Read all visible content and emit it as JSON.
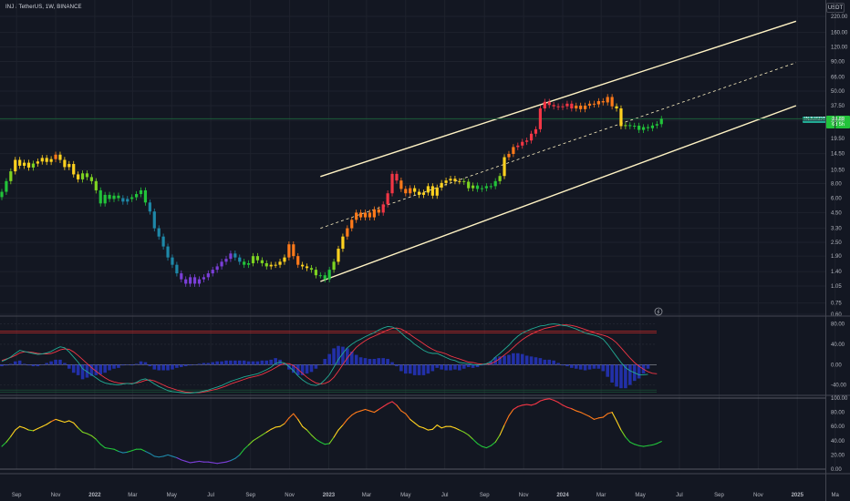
{
  "header": {
    "title": "INJ / TetherUS, 1W, BINANCE",
    "unit": "USDT"
  },
  "price_axis": {
    "ticks": [
      "220.00",
      "160.00",
      "120.00",
      "90.00",
      "66.00",
      "50.00",
      "37.50",
      "28.00",
      "19.50",
      "14.50",
      "10.50",
      "8.00",
      "6.00",
      "4.50",
      "3.30",
      "2.50",
      "1.90",
      "1.40",
      "1.05",
      "0.75",
      "0.60"
    ]
  },
  "osc1_axis": {
    "ticks": [
      "80.00",
      "40.00",
      "0.00",
      "-40.00"
    ]
  },
  "osc2_axis": {
    "ticks": [
      "100.00",
      "80.00",
      "60.00",
      "40.00",
      "20.00",
      "0.00"
    ]
  },
  "time_axis": {
    "labels": [
      "Sep",
      "Nov",
      "2022",
      "Mar",
      "May",
      "Jul",
      "Sep",
      "Nov",
      "2023",
      "Mar",
      "May",
      "Jul",
      "Sep",
      "Nov",
      "2024",
      "Mar",
      "May",
      "Jul",
      "Sep",
      "Nov",
      "2025",
      "Ma"
    ]
  },
  "last_price": {
    "symbol_tag": "INJUSDT",
    "price": "28.89",
    "countdown": "6d 5h"
  },
  "colors": {
    "background": "#131722",
    "channel": "#fff3c4",
    "grid": "#1e222d",
    "separator": "#434651",
    "bull_up": "#22c33a",
    "bear": "#f23645"
  },
  "chart_data": [
    {
      "type": "candlestick",
      "title": "",
      "xlabel": "",
      "ylabel": "",
      "y_scale": "log",
      "ylim": [
        0.6,
        220
      ],
      "x": [
        "2021-08-09",
        "2021-08-16",
        "2021-08-23",
        "2021-08-30",
        "2021-09-06",
        "2021-09-13",
        "2021-09-20",
        "2021-09-27",
        "2021-10-04",
        "2021-10-11",
        "2021-10-18",
        "2021-10-25",
        "2021-11-01",
        "2021-11-08",
        "2021-11-15",
        "2021-11-22",
        "2021-11-29",
        "2021-12-06",
        "2021-12-13",
        "2021-12-20",
        "2021-12-27",
        "2022-01-03",
        "2022-01-10",
        "2022-01-17",
        "2022-01-24",
        "2022-01-31",
        "2022-02-07",
        "2022-02-14",
        "2022-02-21",
        "2022-02-28",
        "2022-03-07",
        "2022-03-14",
        "2022-03-21",
        "2022-03-28",
        "2022-04-04",
        "2022-04-11",
        "2022-04-18",
        "2022-04-25",
        "2022-05-02",
        "2022-05-09",
        "2022-05-16",
        "2022-05-23",
        "2022-05-30",
        "2022-06-06",
        "2022-06-13",
        "2022-06-20",
        "2022-06-27",
        "2022-07-04",
        "2022-07-11",
        "2022-07-18",
        "2022-07-25",
        "2022-08-01",
        "2022-08-08",
        "2022-08-15",
        "2022-08-22",
        "2022-08-29",
        "2022-09-05",
        "2022-09-12",
        "2022-09-19",
        "2022-09-26",
        "2022-10-03",
        "2022-10-10",
        "2022-10-17",
        "2022-10-24",
        "2022-10-31",
        "2022-11-07",
        "2022-11-14",
        "2022-11-21",
        "2022-11-28",
        "2022-12-05",
        "2022-12-12",
        "2022-12-19",
        "2022-12-26",
        "2023-01-02",
        "2023-01-09",
        "2023-01-16",
        "2023-01-23",
        "2023-01-30",
        "2023-02-06",
        "2023-02-13",
        "2023-02-20",
        "2023-02-27",
        "2023-03-06",
        "2023-03-13",
        "2023-03-20",
        "2023-03-27",
        "2023-04-03",
        "2023-04-10",
        "2023-04-17",
        "2023-04-24",
        "2023-05-01",
        "2023-05-08",
        "2023-05-15",
        "2023-05-22",
        "2023-05-29",
        "2023-06-05",
        "2023-06-12",
        "2023-06-19",
        "2023-06-26",
        "2023-07-03",
        "2023-07-10",
        "2023-07-17",
        "2023-07-24",
        "2023-07-31",
        "2023-08-07",
        "2023-08-14",
        "2023-08-21",
        "2023-08-28",
        "2023-09-04",
        "2023-09-11",
        "2023-09-18",
        "2023-09-25",
        "2023-10-02",
        "2023-10-09",
        "2023-10-16",
        "2023-10-23",
        "2023-10-30",
        "2023-11-06",
        "2023-11-13",
        "2023-11-20",
        "2023-11-27",
        "2023-12-04",
        "2023-12-11",
        "2023-12-18",
        "2023-12-25",
        "2024-01-01",
        "2024-01-08",
        "2024-01-15",
        "2024-01-22",
        "2024-01-29",
        "2024-02-05",
        "2024-02-12",
        "2024-02-19",
        "2024-02-26",
        "2024-03-04",
        "2024-03-11",
        "2024-03-18",
        "2024-03-25",
        "2024-04-01",
        "2024-04-08",
        "2024-04-15",
        "2024-04-22",
        "2024-04-29",
        "2024-05-06",
        "2024-05-13",
        "2024-05-20",
        "2024-05-27",
        "2024-06-03"
      ],
      "close": [
        6.8,
        8.4,
        10.2,
        12.8,
        11.4,
        12.1,
        11.0,
        11.9,
        12.4,
        13.3,
        12.3,
        13.0,
        14.2,
        12.8,
        11.1,
        11.8,
        9.6,
        8.7,
        9.8,
        9.1,
        8.4,
        7.0,
        5.4,
        6.4,
        5.9,
        6.3,
        6.0,
        5.6,
        5.9,
        6.1,
        6.5,
        7.0,
        5.5,
        4.6,
        3.3,
        2.8,
        2.3,
        1.85,
        1.6,
        1.35,
        1.2,
        1.1,
        1.25,
        1.1,
        1.2,
        1.25,
        1.35,
        1.45,
        1.55,
        1.7,
        1.8,
        2.0,
        1.85,
        1.7,
        1.6,
        1.65,
        1.9,
        1.75,
        1.65,
        1.55,
        1.6,
        1.6,
        1.7,
        1.85,
        2.4,
        1.9,
        1.6,
        1.55,
        1.5,
        1.45,
        1.3,
        1.3,
        1.2,
        1.45,
        1.7,
        2.2,
        2.8,
        3.3,
        3.9,
        4.5,
        4.1,
        4.5,
        4.1,
        4.8,
        4.5,
        5.3,
        6.6,
        9.7,
        8.5,
        7.2,
        6.6,
        7.3,
        6.8,
        6.4,
        6.7,
        7.6,
        6.3,
        7.4,
        8.1,
        8.5,
        8.8,
        8.4,
        8.4,
        8.3,
        7.3,
        7.7,
        7.2,
        7.3,
        7.6,
        7.6,
        8.4,
        9.3,
        13.5,
        14.4,
        16.5,
        17.0,
        18.3,
        18.8,
        21.5,
        23.5,
        35.5,
        40.5,
        38.0,
        37.0,
        36.5,
        37.0,
        39.0,
        35.5,
        37.5,
        35.0,
        37.5,
        39.0,
        38.5,
        41.0,
        40.0,
        44.5,
        37.0,
        35.5,
        25.0,
        25.5,
        25.0,
        25.2,
        23.2,
        24.5,
        24.0,
        25.3,
        26.0,
        28.89
      ]
    },
    {
      "type": "line",
      "title": "",
      "ylim": [
        -55,
        90
      ],
      "series": [
        {
          "values": [
            6,
            10,
            15,
            22,
            28,
            26,
            24,
            22,
            20,
            21,
            23,
            26,
            31,
            35,
            33,
            25,
            15,
            5,
            -8,
            -14,
            -20,
            -26,
            -32,
            -36,
            -38,
            -39,
            -40,
            -38,
            -37,
            -38,
            -35,
            -30,
            -28,
            -32,
            -38,
            -43,
            -47,
            -51,
            -53,
            -54,
            -55,
            -56,
            -56,
            -55,
            -54,
            -52,
            -50,
            -47,
            -44,
            -41,
            -37,
            -33,
            -30,
            -27,
            -24,
            -22,
            -20,
            -18,
            -14,
            -10,
            -5,
            2,
            5,
            3,
            -4,
            -12,
            -22,
            -30,
            -36,
            -40,
            -41,
            -38,
            -30,
            -20,
            -5,
            10,
            22,
            33,
            40,
            46,
            50,
            55,
            59,
            63,
            68,
            72,
            75,
            74,
            70,
            62,
            54,
            48,
            40,
            34,
            28,
            24,
            22,
            22,
            18,
            14,
            10,
            8,
            4,
            3,
            2,
            0,
            -1,
            0,
            2,
            6,
            15,
            22,
            30,
            38,
            48,
            56,
            62,
            66,
            70,
            73,
            76,
            77,
            79,
            80,
            79,
            77,
            76,
            73,
            70,
            66,
            62,
            60,
            58,
            55,
            50,
            40,
            28,
            16,
            4,
            -6,
            -12,
            -16,
            -20,
            -20,
            -19
          ]
        },
        {
          "values": [
            8,
            11,
            14,
            18,
            23,
            25,
            25,
            24,
            22,
            21,
            21,
            22,
            25,
            29,
            31,
            30,
            25,
            18,
            10,
            2,
            -6,
            -13,
            -20,
            -26,
            -31,
            -34,
            -36,
            -37,
            -37,
            -37,
            -36,
            -34,
            -31,
            -30,
            -32,
            -36,
            -40,
            -44,
            -47,
            -50,
            -52,
            -54,
            -55,
            -55,
            -55,
            -54,
            -52,
            -50,
            -48,
            -45,
            -42,
            -38,
            -35,
            -32,
            -29,
            -26,
            -24,
            -22,
            -19,
            -15,
            -11,
            -6,
            -1,
            2,
            2,
            -2,
            -9,
            -17,
            -25,
            -31,
            -36,
            -38,
            -37,
            -33,
            -25,
            -13,
            0,
            13,
            24,
            34,
            41,
            47,
            52,
            56,
            60,
            64,
            68,
            71,
            72,
            70,
            65,
            59,
            53,
            47,
            41,
            35,
            30,
            26,
            24,
            21,
            17,
            14,
            11,
            8,
            5,
            4,
            2,
            1,
            1,
            2,
            6,
            12,
            19,
            26,
            34,
            42,
            49,
            55,
            60,
            64,
            68,
            71,
            73,
            75,
            77,
            78,
            78,
            77,
            75,
            72,
            69,
            66,
            63,
            60,
            58,
            55,
            50,
            43,
            33,
            23,
            13,
            4,
            -3,
            -9,
            -14,
            -17,
            -18
          ]
        }
      ],
      "reference_lines": [
        80,
        40,
        0,
        -40
      ]
    },
    {
      "type": "line",
      "title": "",
      "ylim": [
        0,
        100
      ],
      "series": [
        {
          "values": [
            32,
            38,
            46,
            55,
            60,
            58,
            55,
            54,
            57,
            60,
            63,
            67,
            70,
            68,
            66,
            68,
            65,
            58,
            52,
            50,
            47,
            42,
            35,
            30,
            29,
            28,
            25,
            23,
            24,
            26,
            28,
            28,
            25,
            22,
            18,
            17,
            18,
            20,
            18,
            16,
            13,
            11,
            9,
            10,
            11,
            10,
            10,
            9,
            8,
            9,
            10,
            12,
            15,
            20,
            28,
            34,
            40,
            44,
            48,
            52,
            56,
            59,
            60,
            64,
            72,
            78,
            70,
            60,
            55,
            48,
            42,
            38,
            35,
            36,
            45,
            55,
            62,
            70,
            76,
            80,
            82,
            84,
            82,
            80,
            84,
            88,
            92,
            95,
            90,
            82,
            78,
            70,
            65,
            60,
            58,
            55,
            56,
            62,
            58,
            60,
            60,
            58,
            55,
            52,
            48,
            42,
            36,
            32,
            30,
            33,
            38,
            48,
            62,
            75,
            84,
            88,
            90,
            91,
            90,
            92,
            96,
            98,
            99,
            97,
            94,
            90,
            87,
            85,
            82,
            80,
            77,
            74,
            70,
            72,
            73,
            78,
            80,
            68,
            55,
            45,
            38,
            35,
            33,
            32,
            33,
            34,
            36,
            39
          ]
        }
      ],
      "reference_lines": [
        100,
        0
      ]
    }
  ]
}
